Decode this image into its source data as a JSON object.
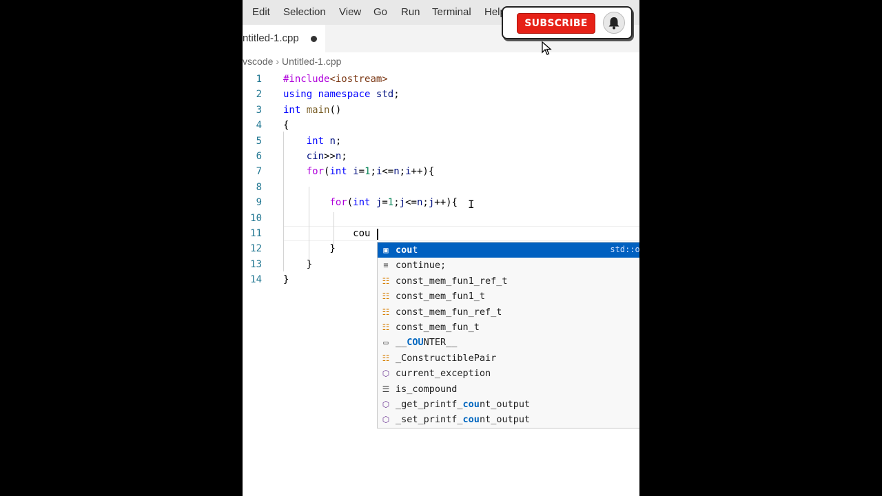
{
  "menu": [
    "Edit",
    "Selection",
    "View",
    "Go",
    "Run",
    "Terminal",
    "Help"
  ],
  "tab": {
    "label": "ntitled-1.cpp"
  },
  "breadcrumb": {
    "folder": "vscode",
    "file": "Untitled-1.cpp"
  },
  "code_lines": [
    "#include<iostream>",
    "using namespace std;",
    "int main()",
    "{",
    "    int n;",
    "    cin>>n;",
    "    for(int i=1;i<=n;i++){",
    "",
    "        for(int j=1;j<=n;j++){",
    "",
    "            cou",
    "        }",
    "    }",
    "}"
  ],
  "line_numbers": [
    "1",
    "2",
    "3",
    "4",
    "5",
    "6",
    "7",
    "8",
    "9",
    "10",
    "11",
    "12",
    "13",
    "14"
  ],
  "suggest": {
    "typed": "cou",
    "items": [
      {
        "label": "cout",
        "kind": "object-icon",
        "detail": "std::os"
      },
      {
        "label": "continue;",
        "kind": "snippet-icon"
      },
      {
        "label": "const_mem_fun1_ref_t",
        "kind": "class-icon"
      },
      {
        "label": "const_mem_fun1_t",
        "kind": "class-icon"
      },
      {
        "label": "const_mem_fun_ref_t",
        "kind": "class-icon"
      },
      {
        "label": "const_mem_fun_t",
        "kind": "class-icon"
      },
      {
        "label": "__COUNTER__",
        "kind": "macro-icon"
      },
      {
        "label": "_ConstructiblePair",
        "kind": "class-icon"
      },
      {
        "label": "current_exception",
        "kind": "function-icon"
      },
      {
        "label": "is_compound",
        "kind": "struct-icon"
      },
      {
        "label": "_get_printf_count_output",
        "kind": "function-icon"
      },
      {
        "label": "_set_printf_count_output",
        "kind": "function-icon"
      }
    ]
  },
  "overlay": {
    "subscribe_label": "SUBSCRIBE",
    "bell": "bell-icon",
    "accent": "#e62117"
  },
  "colors": {
    "selection": "#0060c0",
    "line_number": "#237893",
    "keyword": "#0000ff"
  }
}
